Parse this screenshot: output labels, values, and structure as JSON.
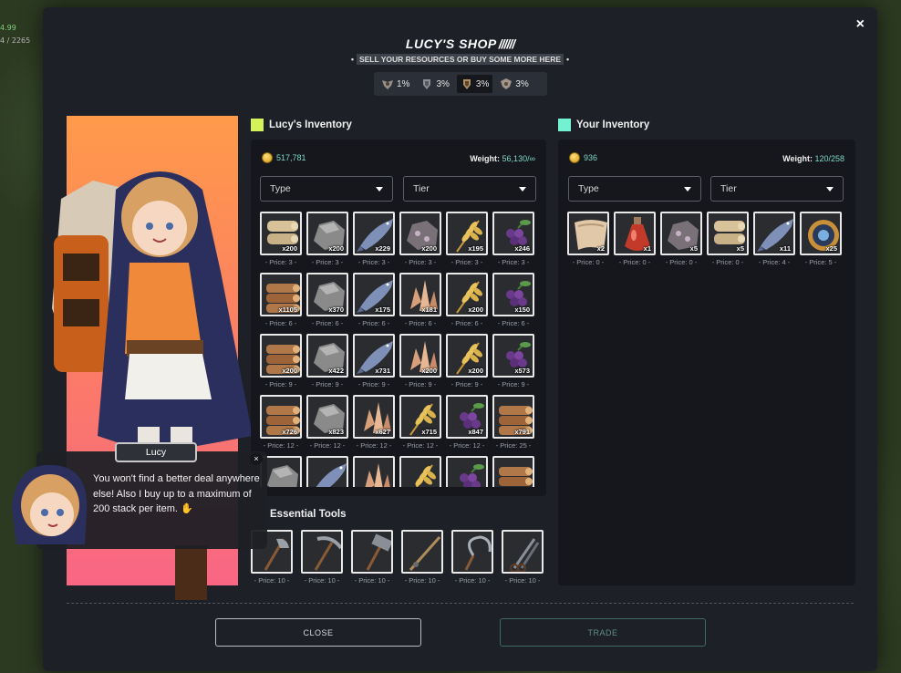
{
  "hud": {
    "line1": "4.99",
    "line2": "4 / 2265"
  },
  "header": {
    "title": "LUCY'S SHOP",
    "title_slashes": "//////",
    "subtitle": "SELL YOUR RESOURCES OR BUY SOME MORE HERE",
    "close_icon": "×",
    "bullet": "•"
  },
  "tiers": [
    {
      "icon": "crest-tier1-icon",
      "value": "1%",
      "active": false
    },
    {
      "icon": "crest-tier2-icon",
      "value": "3%",
      "active": false
    },
    {
      "icon": "crest-tier3-icon",
      "value": "3%",
      "active": true
    },
    {
      "icon": "crest-tier4-icon",
      "value": "3%",
      "active": false
    }
  ],
  "lucy_inventory": {
    "title": "Lucy's Inventory",
    "swatch_color": "#d6f25a",
    "gold": "517,781",
    "weight_label": "Weight:",
    "weight_value": "56,130/∞",
    "type_label": "Type",
    "tier_label": "Tier",
    "items": [
      {
        "icon": "plank-icon",
        "qty": "x200",
        "price": "- Price: 3 -"
      },
      {
        "icon": "stone-icon",
        "qty": "x200",
        "price": "- Price: 3 -"
      },
      {
        "icon": "fish-icon",
        "qty": "x229",
        "price": "- Price: 3 -"
      },
      {
        "icon": "ore-icon",
        "qty": "x200",
        "price": "- Price: 3 -"
      },
      {
        "icon": "wheat-icon",
        "qty": "x195",
        "price": "- Price: 3 -"
      },
      {
        "icon": "berry-icon",
        "qty": "x246",
        "price": "- Price: 3 -"
      },
      {
        "icon": "log-icon",
        "qty": "x1105",
        "price": "- Price: 6 -"
      },
      {
        "icon": "stone-icon",
        "qty": "x370",
        "price": "- Price: 6 -"
      },
      {
        "icon": "fish-icon",
        "qty": "x175",
        "price": "- Price: 6 -"
      },
      {
        "icon": "crystal-icon",
        "qty": "x181",
        "price": "- Price: 6 -"
      },
      {
        "icon": "wheat-icon",
        "qty": "x200",
        "price": "- Price: 6 -"
      },
      {
        "icon": "berry-icon",
        "qty": "x150",
        "price": "- Price: 6 -"
      },
      {
        "icon": "log-icon",
        "qty": "x200",
        "price": "- Price: 9 -"
      },
      {
        "icon": "stone-icon",
        "qty": "x422",
        "price": "- Price: 9 -"
      },
      {
        "icon": "fish-icon",
        "qty": "x731",
        "price": "- Price: 9 -"
      },
      {
        "icon": "crystal-icon",
        "qty": "x200",
        "price": "- Price: 9 -"
      },
      {
        "icon": "wheat-icon",
        "qty": "x200",
        "price": "- Price: 9 -"
      },
      {
        "icon": "berry-icon",
        "qty": "x573",
        "price": "- Price: 9 -"
      },
      {
        "icon": "log-icon",
        "qty": "x726",
        "price": "- Price: 12 -"
      },
      {
        "icon": "stone-icon",
        "qty": "x823",
        "price": "- Price: 12 -"
      },
      {
        "icon": "crystal-icon",
        "qty": "x627",
        "price": "- Price: 12 -"
      },
      {
        "icon": "wheat-icon",
        "qty": "x715",
        "price": "- Price: 12 -"
      },
      {
        "icon": "berry-icon",
        "qty": "x847",
        "price": "- Price: 12 -"
      },
      {
        "icon": "log-icon",
        "qty": "x791",
        "price": "- Price: 25 -"
      },
      {
        "icon": "stone-icon",
        "qty": "",
        "price": ""
      },
      {
        "icon": "fish-icon",
        "qty": "",
        "price": ""
      },
      {
        "icon": "crystal-icon",
        "qty": "",
        "price": ""
      },
      {
        "icon": "wheat-icon",
        "qty": "",
        "price": ""
      },
      {
        "icon": "berry-icon",
        "qty": "",
        "price": ""
      },
      {
        "icon": "log-icon",
        "qty": "",
        "price": ""
      }
    ]
  },
  "your_inventory": {
    "title": "Your Inventory",
    "swatch_color": "#74f0d2",
    "gold": "936",
    "weight_label": "Weight:",
    "weight_value": "120/258",
    "type_label": "Type",
    "tier_label": "Tier",
    "items": [
      {
        "icon": "cloth-icon",
        "qty": "x2",
        "price": "- Price: 0 -"
      },
      {
        "icon": "potion-icon",
        "qty": "x1",
        "price": "- Price: 0 -"
      },
      {
        "icon": "ore-icon",
        "qty": "x5",
        "price": "- Price: 0 -"
      },
      {
        "icon": "plank-icon",
        "qty": "x5",
        "price": "- Price: 0 -"
      },
      {
        "icon": "fish-icon",
        "qty": "x11",
        "price": "- Price: 4 -"
      },
      {
        "icon": "orb-icon",
        "qty": "x25",
        "price": "- Price: 5 -"
      }
    ]
  },
  "essential_tools": {
    "title": "Essential Tools",
    "items": [
      {
        "icon": "axe-icon",
        "price": "- Price: 10 -"
      },
      {
        "icon": "pickaxe-icon",
        "price": "- Price: 10 -"
      },
      {
        "icon": "hammer-icon",
        "price": "- Price: 10 -"
      },
      {
        "icon": "fishing-rod-icon",
        "price": "- Price: 10 -"
      },
      {
        "icon": "sickle-icon",
        "price": "- Price: 10 -"
      },
      {
        "icon": "shears-icon",
        "price": "- Price: 10 -"
      }
    ]
  },
  "dialogue": {
    "speaker": "Lucy",
    "text": "You won't find a better deal anywhere else! Also I buy up to a maximum of 200 stack per item. ✋",
    "close_icon": "×"
  },
  "buttons": {
    "close": "CLOSE",
    "trade": "TRADE"
  },
  "colors": {
    "modal_bg": "#1d2027",
    "panel_bg": "#15171c",
    "accent_teal": "#7fd7c7",
    "portrait_top": "#ff9a4a",
    "portrait_bottom": "#f96684"
  }
}
